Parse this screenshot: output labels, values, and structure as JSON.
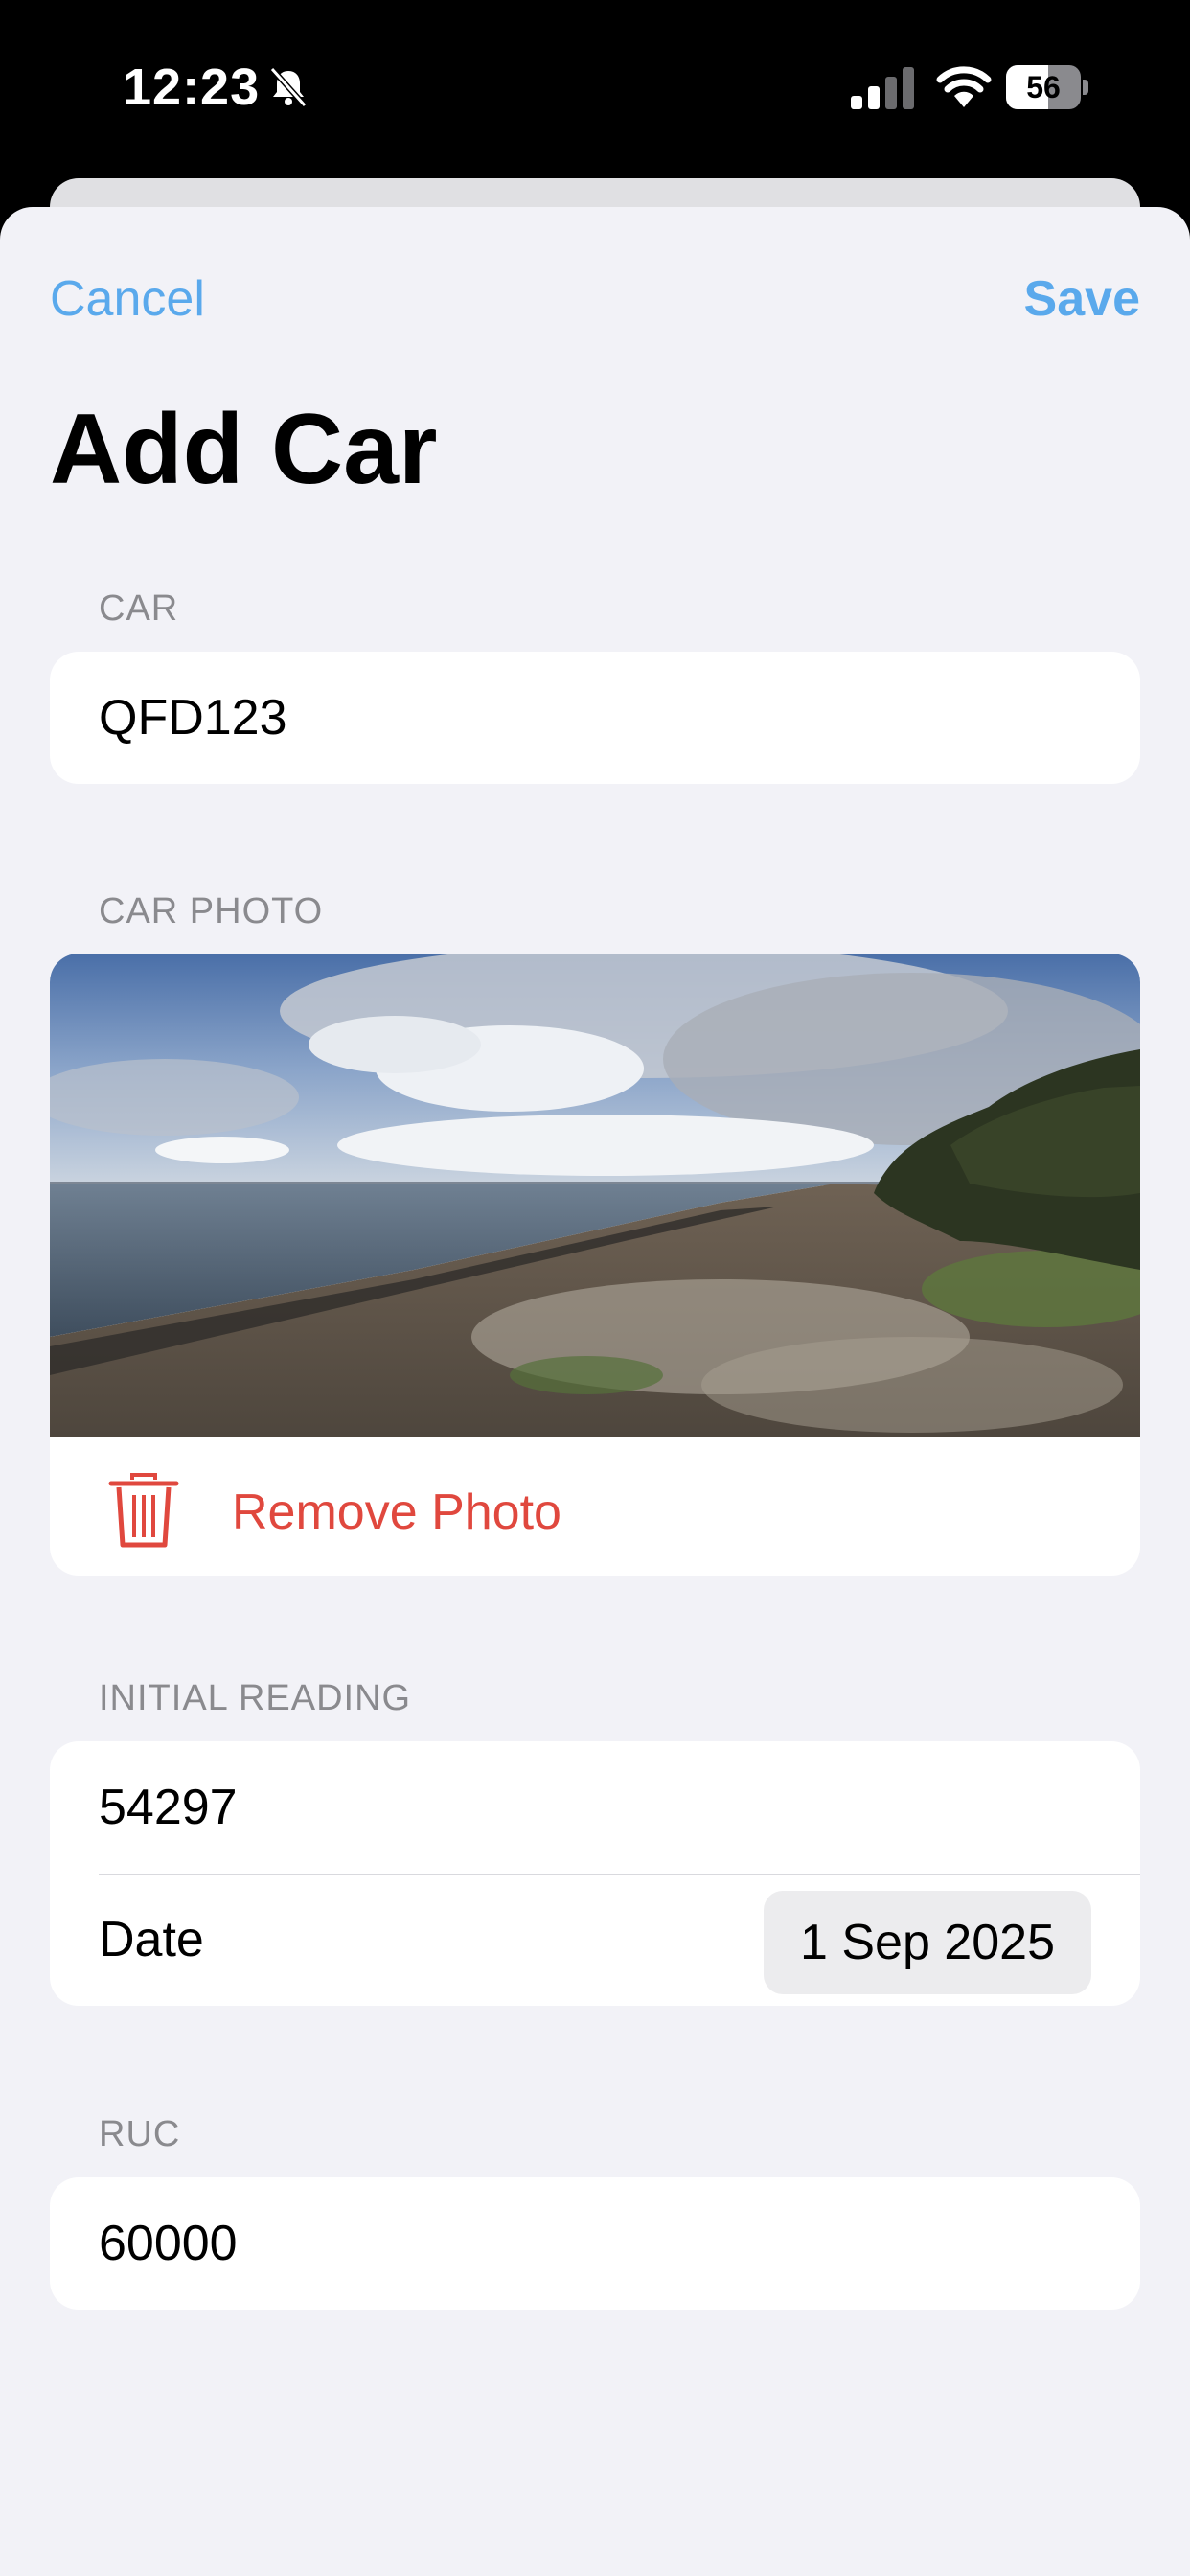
{
  "status_bar": {
    "time": "12:23",
    "battery_level": "56",
    "icons": [
      "bell-slash-icon",
      "cellular-signal-icon",
      "wifi-icon",
      "battery-icon"
    ]
  },
  "nav": {
    "cancel_label": "Cancel",
    "save_label": "Save",
    "accent_color": "#5aa9ec"
  },
  "title": "Add Car",
  "car_section": {
    "header": "CAR",
    "value": "QFD123"
  },
  "photo_section": {
    "header": "CAR PHOTO",
    "remove_label": "Remove Photo",
    "remove_icon": "trash-icon",
    "destructive_color": "#e0483e"
  },
  "reading_section": {
    "header": "INITIAL READING",
    "value": "54297",
    "date_label": "Date",
    "date_value": "1 Sep 2025"
  },
  "ruc_section": {
    "header": "RUC",
    "value": "60000"
  }
}
